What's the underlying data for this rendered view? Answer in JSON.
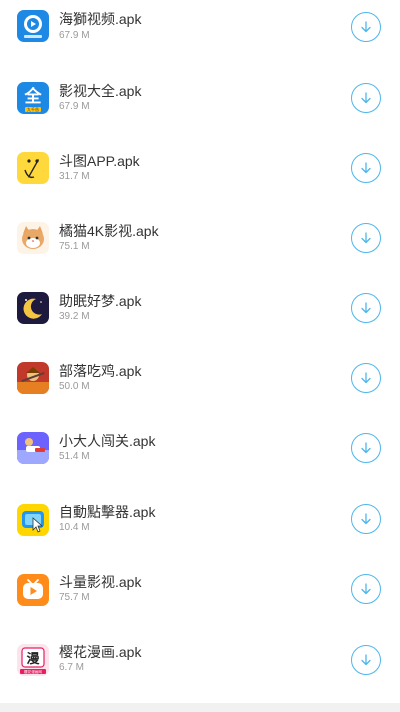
{
  "apps": [
    {
      "name": "海獅视频.apk",
      "size": "67.9 M",
      "icon": "haishi-video-icon"
    },
    {
      "name": "影视大全.apk",
      "size": "67.9 M",
      "icon": "yingshi-daquan-icon"
    },
    {
      "name": "斗图APP.apk",
      "size": "31.7 M",
      "icon": "doutu-app-icon"
    },
    {
      "name": "橘猫4K影视.apk",
      "size": "75.1 M",
      "icon": "orange-cat-icon"
    },
    {
      "name": "助眠好梦.apk",
      "size": "39.2 M",
      "icon": "moon-sleep-icon"
    },
    {
      "name": "部落吃鸡.apk",
      "size": "50.0 M",
      "icon": "tribe-game-icon"
    },
    {
      "name": "小大人闯关.apk",
      "size": "51.4 M",
      "icon": "runner-game-icon"
    },
    {
      "name": "自動點擊器.apk",
      "size": "10.4 M",
      "icon": "auto-clicker-icon"
    },
    {
      "name": "斗量影视.apk",
      "size": "75.7 M",
      "icon": "tv-play-icon"
    },
    {
      "name": "樱花漫画.apk",
      "size": "6.7 M",
      "icon": "manga-icon"
    }
  ],
  "icon_text": {
    "quan": "全",
    "quan_badge": "九千岳",
    "manhua": "漫",
    "manhua_badge": "樱花漫画网"
  },
  "accent_color": "#4db6ec"
}
